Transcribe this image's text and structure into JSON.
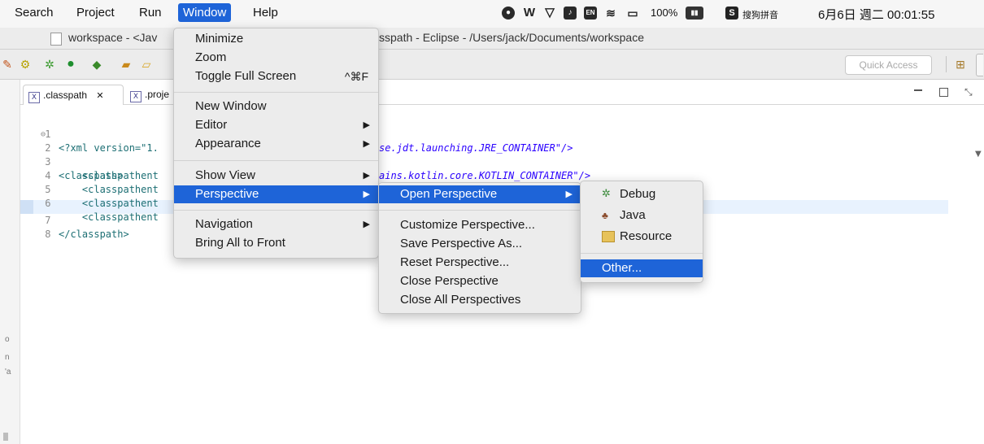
{
  "menubar": {
    "items": [
      "Search",
      "Project",
      "Run",
      "Window",
      "Help"
    ],
    "tray": {
      "battery": "100%",
      "input_method": "搜狗拼音",
      "datetime": "6月6日 週二 00:01:55"
    }
  },
  "titlebar": {
    "left_title": "workspace - <Jav",
    "right_title": "sspath - Eclipse - /Users/jack/Documents/workspace"
  },
  "toolbar": {
    "quick_access_placeholder": "Quick Access"
  },
  "editor": {
    "tabs": [
      ".classpath",
      ".proje"
    ],
    "lines": [
      {
        "n": "1",
        "text": "<?xml version=\"1."
      },
      {
        "n": "2",
        "text": "<classpath>"
      },
      {
        "n": "3",
        "text": "    <classpathent"
      },
      {
        "n": "4",
        "text": "    <classpathent"
      },
      {
        "n": "5",
        "text": "    <classpathent"
      },
      {
        "n": "6",
        "text": "    <classpathent"
      },
      {
        "n": "7",
        "text": "</classpath>"
      },
      {
        "n": "8",
        "text": ""
      }
    ],
    "frag_jre": "se.jdt.launching.JRE_CONTAINER\"/>",
    "frag_kotlin": "ains.kotlin.core.KOTLIN_CONTAINER\"/>"
  },
  "window_menu": {
    "minimize": "Minimize",
    "zoom": "Zoom",
    "toggle_full_screen": "Toggle Full Screen",
    "toggle_shortcut": "^⌘F",
    "new_window": "New Window",
    "editor": "Editor",
    "appearance": "Appearance",
    "show_view": "Show View",
    "perspective": "Perspective",
    "navigation": "Navigation",
    "bring_all_to_front": "Bring All to Front"
  },
  "perspective_menu": {
    "open_perspective": "Open Perspective",
    "customize": "Customize Perspective...",
    "save_as": "Save Perspective As...",
    "reset": "Reset Perspective...",
    "close": "Close Perspective",
    "close_all": "Close All Perspectives"
  },
  "open_perspective_menu": {
    "debug": "Debug",
    "java": "Java",
    "resource": "Resource",
    "other": "Other..."
  },
  "colors": {
    "highlight": "#1e64d8"
  }
}
